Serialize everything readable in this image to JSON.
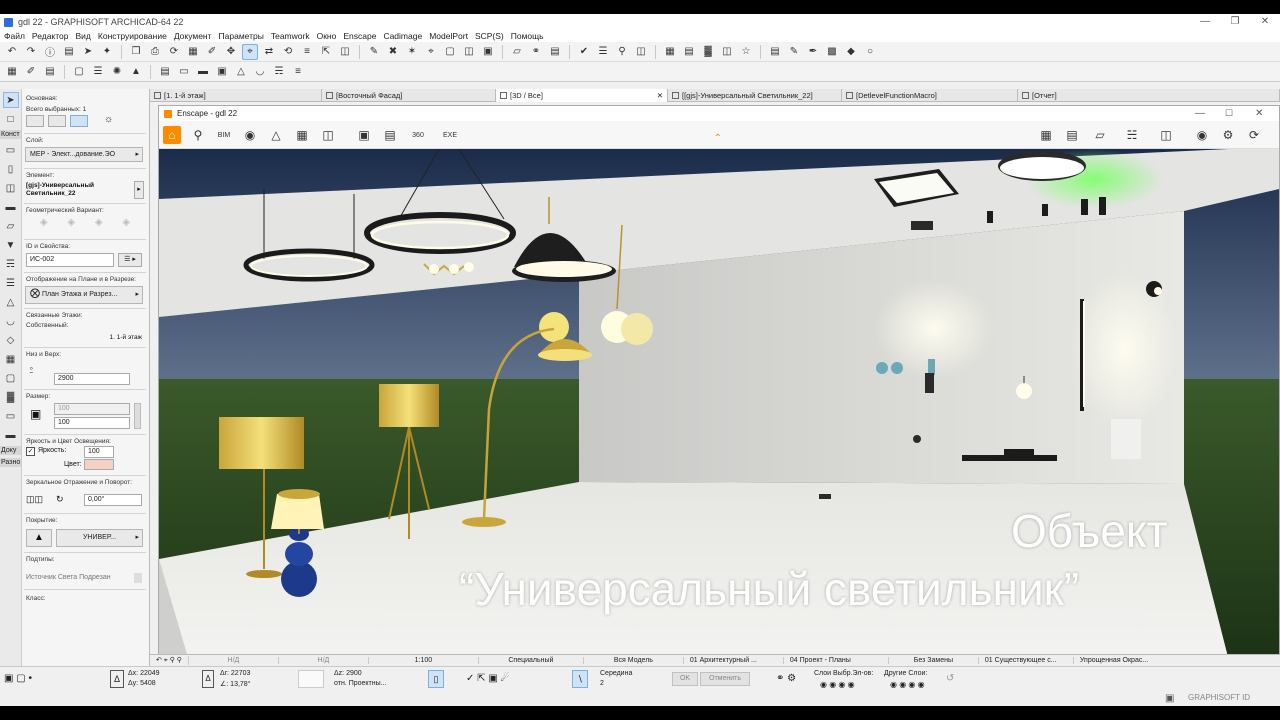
{
  "window": {
    "title": "gdl 22 - GRAPHISOFT ARCHICAD-64 22"
  },
  "menu": [
    "Файл",
    "Редактор",
    "Вид",
    "Конструирование",
    "Документ",
    "Параметры",
    "Teamwork",
    "Окно",
    "Enscape",
    "Cadimage",
    "ModelPort",
    "SCP(S)",
    "Помощь"
  ],
  "tabs": [
    {
      "label": "[1. 1-й этаж]",
      "active": false
    },
    {
      "label": "[Восточный Фасад]",
      "active": false
    },
    {
      "label": "[3D / Все]",
      "active": true
    },
    {
      "label": "[[gjs]-Универсальный Светильник_22]",
      "active": false
    },
    {
      "label": "[DetlevelFunctionMacro]",
      "active": false
    },
    {
      "label": "[Отчет]",
      "active": false
    }
  ],
  "toolbox": {
    "sections": [
      "Конст",
      "Доку",
      "Разно"
    ]
  },
  "infobox": {
    "basic_label": "Основная:",
    "selected_label": "Всего выбранных: 1",
    "layer_label": "Слой:",
    "layer_value": "MEP - Элект...дование.ЭО",
    "element_label": "Элемент:",
    "element_value": "[gjs]-Универсальный Светильник_22",
    "geom_label": "Геометрический Вариант:",
    "id_label": "ID и Свойства:",
    "id_value": "ИС-002",
    "display_label": "Отображение на Плане и в Разрезе:",
    "display_value": "План Этажа и Разрез...",
    "linked_label": "Связанные Этажи:",
    "own_label": "Собственный:",
    "own_value": "1. 1-й этаж",
    "bottom_top_label": "Низ и Верх:",
    "bottom_top_value": "2900",
    "size_label": "Размер:",
    "size_a": "100",
    "size_b": "100",
    "light_label": "Яркость и Цвет Освещения:",
    "brightness_label": "Яркость:",
    "brightness_value": "100",
    "color_label": "Цвет:",
    "mirror_label": "Зеркальное Отражение и Поворот:",
    "angle_value": "0,00°",
    "cover_label": "Покрытие:",
    "cover_value": "УНИВЕР...",
    "subtype_label": "Подтипы:",
    "subtype_value": "Источник Света Подрезан",
    "class_label": "Класс:"
  },
  "enscape": {
    "title": "Enscape - gdl 22"
  },
  "overlay": {
    "line1": "Объект",
    "line2": "“Универсальный светильник”"
  },
  "bottombar": [
    "Н/Д",
    "Н/Д",
    "1:100",
    "Специальный",
    "Вся Модель",
    "01 Архитектурный ...",
    "04 Проект - Планы",
    "Без Замены",
    "01 Существующее с...",
    "Упрощенная Окрас..."
  ],
  "status": {
    "dx": "22049",
    "dy": "5408",
    "da": "22703",
    "angle": "13,78°",
    "dz": "2900",
    "ref": "отн. Проектны...",
    "snap": "Середина",
    "snap_n": "2",
    "ok": "OK",
    "cancel": "Отменить",
    "layers_label": "Слои Выбр.Эл-ов:",
    "other_label": "Другие Слои:"
  },
  "footer": {
    "brand": "GRAPHISOFT ID"
  }
}
